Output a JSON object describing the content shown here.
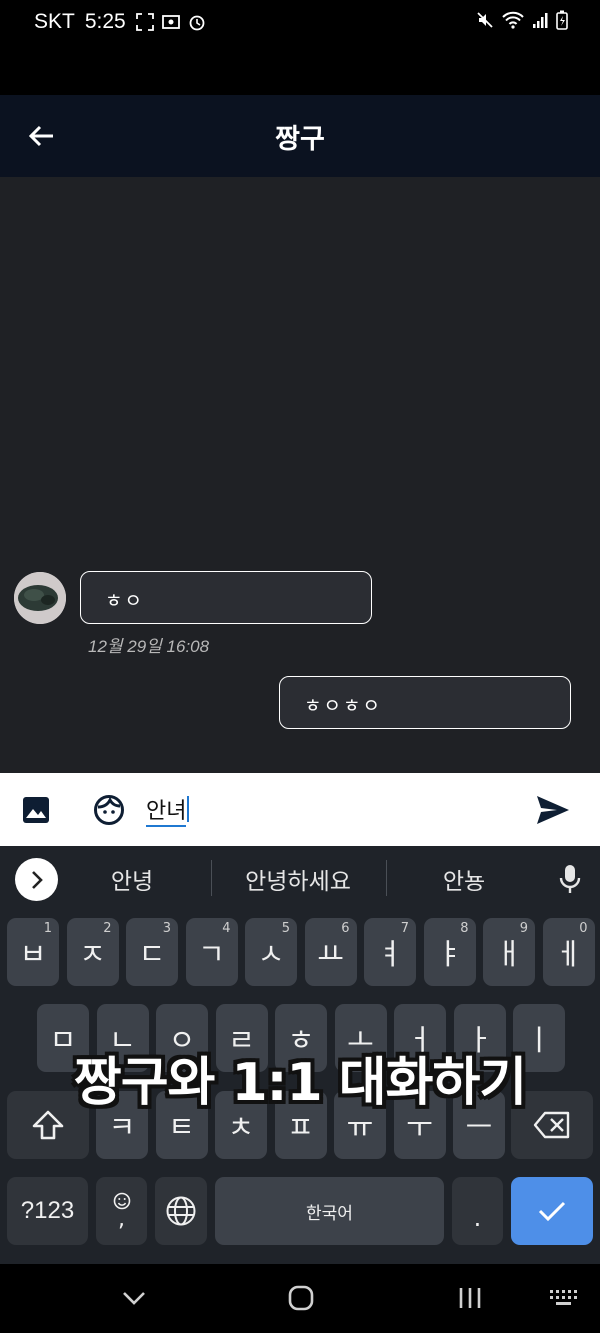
{
  "status_bar": {
    "carrier": "SKT",
    "time": "5:25"
  },
  "app_bar": {
    "title": "짱구"
  },
  "messages": {
    "incoming": {
      "text": "ㅎㅇ",
      "timestamp": "12월 29일  16:08"
    },
    "outgoing": {
      "text": "ㅎㅇㅎㅇ"
    }
  },
  "input_bar": {
    "value": "안녀"
  },
  "keyboard": {
    "suggestions": [
      "안녕",
      "안녕하세요",
      "안뇽"
    ],
    "row1": [
      {
        "label": "ㅂ",
        "hint": "1"
      },
      {
        "label": "ㅈ",
        "hint": "2"
      },
      {
        "label": "ㄷ",
        "hint": "3"
      },
      {
        "label": "ㄱ",
        "hint": "4"
      },
      {
        "label": "ㅅ",
        "hint": "5"
      },
      {
        "label": "ㅛ",
        "hint": "6"
      },
      {
        "label": "ㅕ",
        "hint": "7"
      },
      {
        "label": "ㅑ",
        "hint": "8"
      },
      {
        "label": "ㅐ",
        "hint": "9"
      },
      {
        "label": "ㅔ",
        "hint": "0"
      }
    ],
    "row2": [
      "ㅁ",
      "ㄴ",
      "ㅇ",
      "ㄹ",
      "ㅎ",
      "ㅗ",
      "ㅓ",
      "ㅏ",
      "ㅣ"
    ],
    "row3": [
      "ㅋ",
      "ㅌ",
      "ㅊ",
      "ㅍ",
      "ㅠ",
      "ㅜ",
      "ㅡ"
    ],
    "symbols_label": "?123",
    "comma_label": ",",
    "space_label": "한국어",
    "period_label": "."
  },
  "caption": "짱구와 1:1 대화하기"
}
